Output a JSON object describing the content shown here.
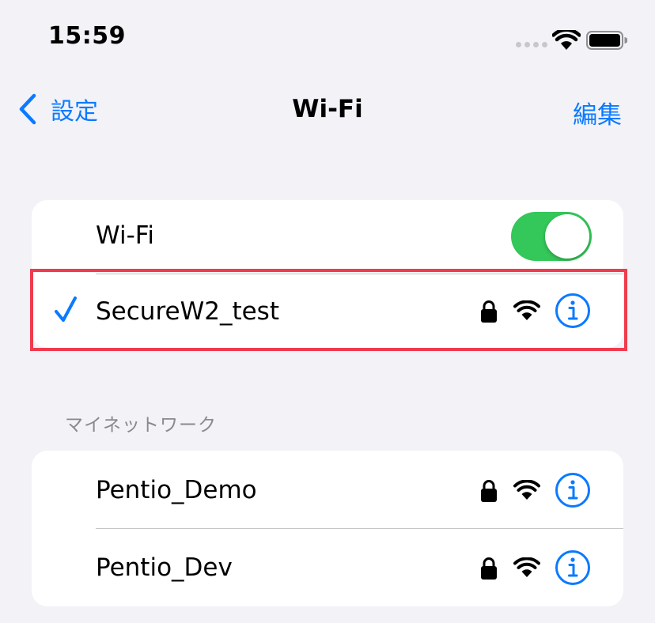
{
  "status_bar": {
    "time": "15:59"
  },
  "nav": {
    "back_label": "設定",
    "title": "Wi-Fi",
    "edit_label": "編集"
  },
  "wifi_toggle": {
    "label": "Wi-Fi",
    "on": true
  },
  "connected_network": {
    "name": "SecureW2_test",
    "secured": true
  },
  "my_networks": {
    "header": "マイネットワーク",
    "items": [
      {
        "name": "Pentio_Demo",
        "secured": true
      },
      {
        "name": "Pentio_Dev",
        "secured": true
      }
    ]
  },
  "colors": {
    "accent": "#0a7aff",
    "toggle_on": "#34c759",
    "highlight": "#f03b4e",
    "background": "#f2f2f7"
  },
  "icons": [
    "chevron-left-icon",
    "wifi-icon",
    "battery-icon",
    "checkmark-icon",
    "lock-icon",
    "info-icon"
  ]
}
